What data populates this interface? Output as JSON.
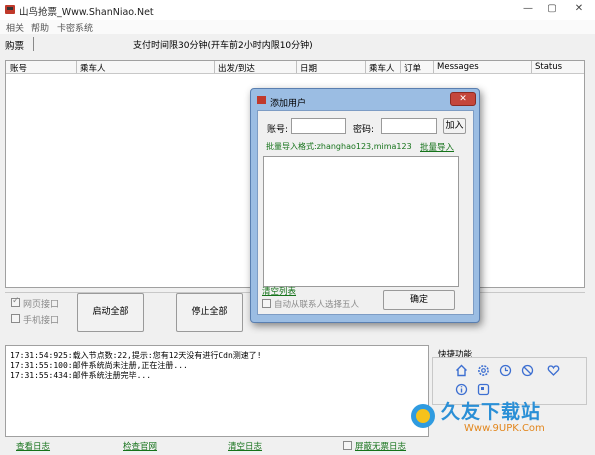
{
  "window": {
    "title": "山鸟抢票_Www.ShanNiao.Net",
    "controls": [
      "—",
      "▢",
      "✕"
    ]
  },
  "menu": [
    "相关",
    "帮助",
    "卡密系统"
  ],
  "toolbar": {
    "tab_label": "购票",
    "notice": "支付时间限30分钟(开车前2小时内限10分钟)"
  },
  "table": {
    "columns": [
      "账号",
      "乘车人",
      "出发/到达",
      "日期",
      "乘车人",
      "订单",
      "Messages",
      "Status"
    ]
  },
  "controls": {
    "network_port_label": "网页接口",
    "network_port_checked": true,
    "mobile_port_label": "手机接口",
    "mobile_port_checked": false,
    "start_all_label": "启动全部",
    "stop_all_label": "停止全部"
  },
  "log": {
    "lines": [
      "17:31:54:925:载入节点数:22,提示:您有12天没有进行Cdn测速了!",
      "17:31:55:100:邮件系统尚未注册,正在注册...",
      "17:31:55:434:邮件系统注册完毕..."
    ],
    "view_log_label": "查看日志",
    "check_site_label": "检查官网",
    "clear_log_label": "清空日志",
    "mute_label": "屏蔽无票日志"
  },
  "quick": {
    "title": "快捷功能",
    "icons": [
      "home-icon",
      "settings-icon",
      "clock-icon",
      "block-icon",
      "heart-icon",
      "info-icon",
      "qr-icon"
    ],
    "accent": "#3d6fd1"
  },
  "dialog": {
    "title": "添加用户",
    "close_label": "✕",
    "account_label": "账号:",
    "account_value": "",
    "password_label": "密码:",
    "password_value": "",
    "add_label": "加入",
    "format_hint": "批量导入格式:zhanghao123,mima123",
    "batch_import_label": "批量导入",
    "clear_list_label": "清空列表",
    "auto_select_label": "自动从联系人选择五人",
    "auto_select_checked": false,
    "confirm_label": "确定"
  },
  "watermark": {
    "name": "久友下载站",
    "url": "Www.9UPK.Com"
  },
  "colors": {
    "link": "#16731b",
    "dialog_frame": "#9bbde3",
    "close_red": "#c4463b"
  }
}
